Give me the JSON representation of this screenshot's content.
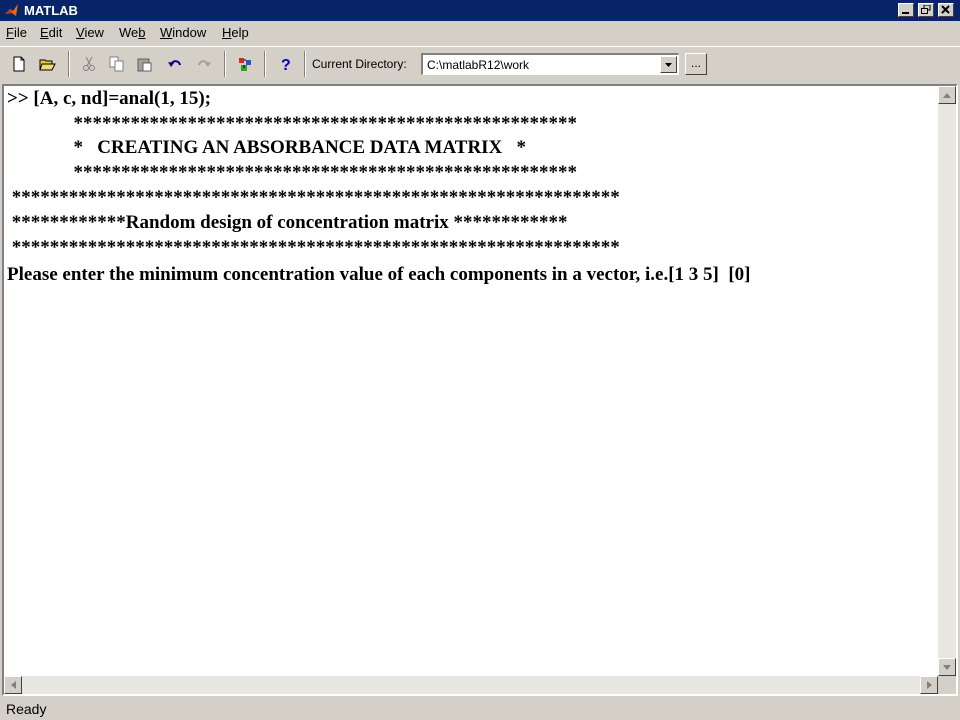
{
  "window": {
    "title": "MATLAB"
  },
  "menu": {
    "items": [
      {
        "pre": "",
        "ul": "F",
        "post": "ile"
      },
      {
        "pre": "",
        "ul": "E",
        "post": "dit"
      },
      {
        "pre": "",
        "ul": "V",
        "post": "iew"
      },
      {
        "pre": "We",
        "ul": "b",
        "post": ""
      },
      {
        "pre": "",
        "ul": "W",
        "post": "indow"
      },
      {
        "pre": "",
        "ul": "H",
        "post": "elp"
      }
    ]
  },
  "toolbar": {
    "icons": [
      "new-file-icon",
      "open-folder-icon",
      "cut-icon",
      "copy-icon",
      "paste-icon",
      "undo-icon",
      "redo-icon",
      "simulink-icon",
      "help-icon"
    ],
    "current_directory_label": "Current Directory:",
    "current_directory_value": "C:\\matlabR12\\work",
    "browse_label": "..."
  },
  "command_window": {
    "lines": [
      ">> [A, c, nd]=anal(1, 15);",
      "              *****************************************************",
      "              *   CREATING AN ABSORBANCE DATA MATRIX   *",
      "              *****************************************************",
      " ****************************************************************",
      " ************Random design of concentration matrix ************",
      " ****************************************************************",
      "Please enter the minimum concentration value of each components in a vector, i.e.[1 3 5]  [0]"
    ]
  },
  "status": {
    "text": "Ready"
  },
  "colors": {
    "titlebar": "#0a246a",
    "chrome": "#d4d0c8",
    "console_bg": "#ffffff"
  }
}
